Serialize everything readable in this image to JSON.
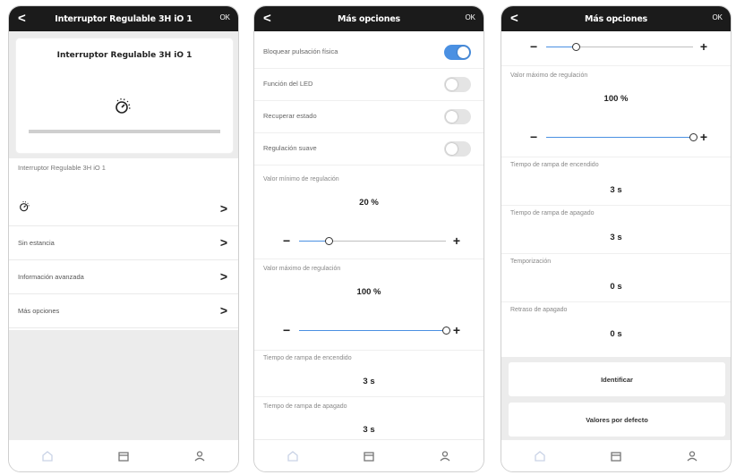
{
  "colors": {
    "accent": "#4a90e2",
    "topbar": "#1b1b1b",
    "background_gray": "#ececec"
  },
  "phone1": {
    "header": {
      "back": "<",
      "title": "Interruptor Regulable 3H iO 1",
      "ok": "OK"
    },
    "device_card": {
      "name": "Interruptor Regulable 3H iO 1",
      "icon": "dimmer-knob-icon"
    },
    "device_label": "Interruptor Regulable 3H iO 1",
    "menu": [
      {
        "label": "",
        "icon": "dimmer-knob-icon"
      },
      {
        "label": "Sin estancia"
      },
      {
        "label": "Información avanzada"
      },
      {
        "label": "Más opciones"
      }
    ]
  },
  "phone2": {
    "header": {
      "back": "<",
      "title": "Más opciones",
      "ok": "OK"
    },
    "toggles": [
      {
        "label": "Bloquear pulsación física",
        "on": true
      },
      {
        "label": "Función del LED",
        "on": false
      },
      {
        "label": "Recuperar estado",
        "on": false
      },
      {
        "label": "Regulación suave",
        "on": false
      }
    ],
    "min_reg": {
      "label": "Valor mínimo de regulación",
      "value": "20 %",
      "level": 0.2
    },
    "max_reg": {
      "label": "Valor máximo de regulación",
      "value": "100 %",
      "level": 1.0
    },
    "ramp_on": {
      "label": "Tiempo de rampa de encendido",
      "value": "3 s"
    },
    "ramp_off": {
      "label": "Tiempo de rampa de apagado",
      "value": "3 s"
    }
  },
  "phone3": {
    "header": {
      "back": "<",
      "title": "Más opciones",
      "ok": "OK"
    },
    "top_slider_level": 0.2,
    "max_reg": {
      "label": "Valor máximo de regulación",
      "value": "100 %",
      "level": 1.0
    },
    "ramp_on": {
      "label": "Tiempo de rampa de encendido",
      "value": "3 s"
    },
    "ramp_off": {
      "label": "Tiempo de rampa de apagado",
      "value": "3 s"
    },
    "timer": {
      "label": "Temporización",
      "value": "0 s"
    },
    "delay": {
      "label": "Retraso de apagado",
      "value": "0 s"
    },
    "buttons": {
      "identify": "Identificar",
      "defaults": "Valores por defecto"
    }
  },
  "symbols": {
    "minus": "−",
    "plus": "+",
    "chevron": ">"
  },
  "tabbar": {
    "icons": [
      "home-icon",
      "devices-box-icon",
      "user-icon"
    ]
  }
}
